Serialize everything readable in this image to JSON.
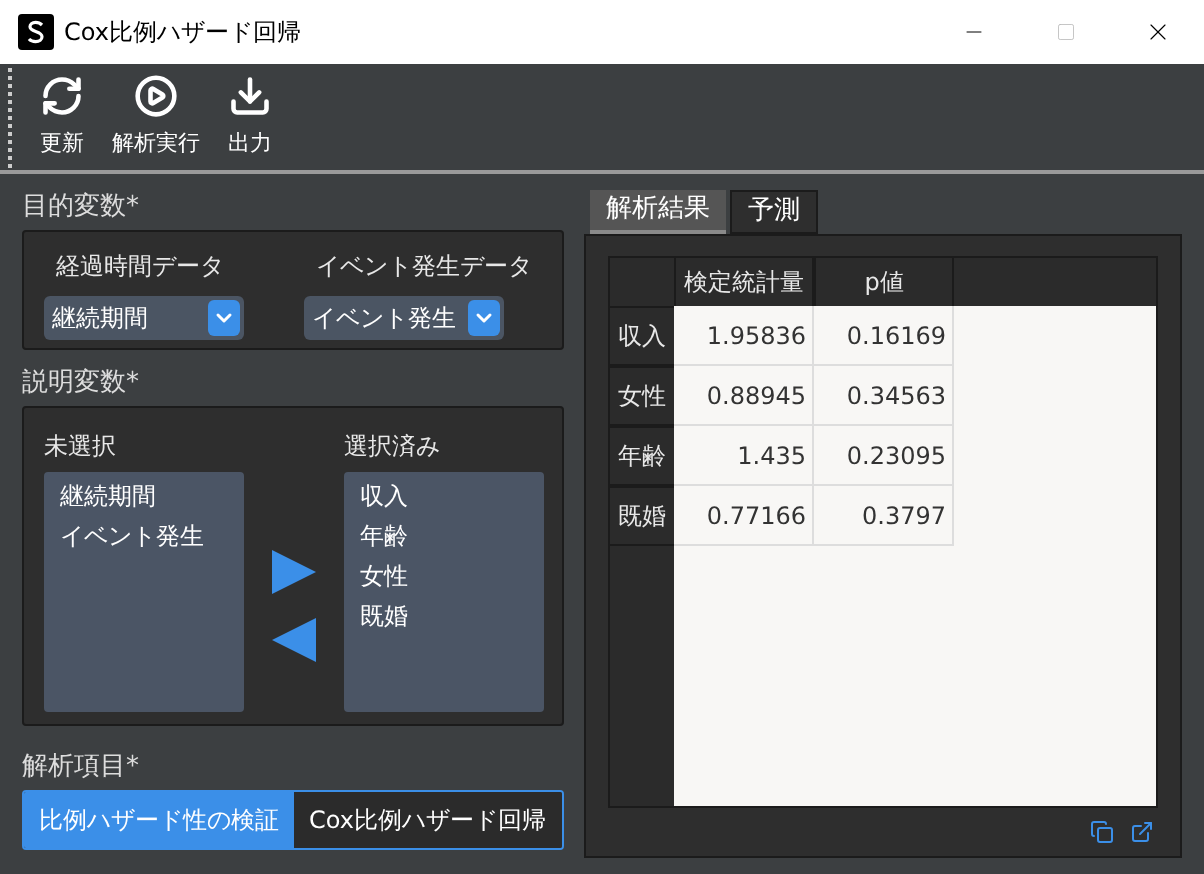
{
  "window": {
    "title": "Cox比例ハザード回帰"
  },
  "toolbar": [
    {
      "label": "更新",
      "kind": "refresh"
    },
    {
      "label": "解析実行",
      "kind": "run"
    },
    {
      "label": "出力",
      "kind": "export"
    }
  ],
  "target": {
    "title": "目的変数*",
    "fields": [
      {
        "label": "経過時間データ",
        "value": "継続期間"
      },
      {
        "label": "イベント発生データ",
        "value": "イベント発生"
      }
    ]
  },
  "explanatory": {
    "title": "説明変数*",
    "unselected": {
      "label": "未選択",
      "items": [
        "継続期間",
        "イベント発生"
      ]
    },
    "selected": {
      "label": "選択済み",
      "items": [
        "収入",
        "年齢",
        "女性",
        "既婚"
      ]
    }
  },
  "analysis": {
    "title": "解析項目*",
    "options": [
      {
        "label": "比例ハザード性の検証",
        "selected": true
      },
      {
        "label": "Cox比例ハザード回帰",
        "selected": false
      }
    ]
  },
  "tabs": [
    {
      "label": "解析結果",
      "selected": true
    },
    {
      "label": "予測",
      "selected": false
    }
  ],
  "table": {
    "columns": [
      "検定統計量",
      "p値"
    ],
    "rows": [
      {
        "header": "収入",
        "cells": [
          "1.95836",
          "0.16169"
        ]
      },
      {
        "header": "女性",
        "cells": [
          "0.88945",
          "0.34563"
        ]
      },
      {
        "header": "年齢",
        "cells": [
          "1.435",
          "0.23095"
        ]
      },
      {
        "header": "既婚",
        "cells": [
          "0.77166",
          "0.3797"
        ]
      }
    ]
  }
}
